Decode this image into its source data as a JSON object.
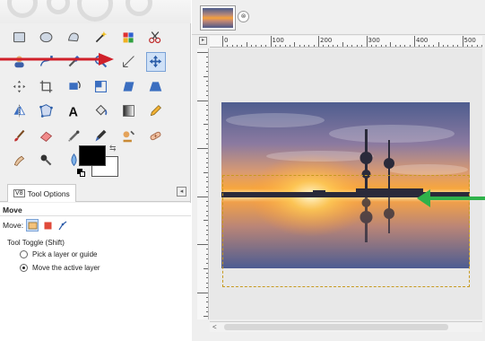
{
  "toolbox": {
    "tools": [
      {
        "name": "rect-select-icon",
        "active": false
      },
      {
        "name": "ellipse-select-icon",
        "active": false
      },
      {
        "name": "free-select-icon",
        "active": false
      },
      {
        "name": "fuzzy-select-icon",
        "active": false
      },
      {
        "name": "color-select-icon",
        "active": false
      },
      {
        "name": "scissors-select-icon",
        "active": false
      },
      {
        "name": "foreground-select-icon",
        "active": false
      },
      {
        "name": "paths-icon",
        "active": false
      },
      {
        "name": "color-picker-icon",
        "active": false
      },
      {
        "name": "zoom-icon",
        "active": false
      },
      {
        "name": "measure-icon",
        "active": false
      },
      {
        "name": "move-tool-icon",
        "active": true
      },
      {
        "name": "align-icon",
        "active": false
      },
      {
        "name": "crop-icon",
        "active": false
      },
      {
        "name": "rotate-icon",
        "active": false
      },
      {
        "name": "scale-icon",
        "active": false
      },
      {
        "name": "shear-icon",
        "active": false
      },
      {
        "name": "perspective-icon",
        "active": false
      },
      {
        "name": "flip-icon",
        "active": false
      },
      {
        "name": "cage-transform-icon",
        "active": false
      },
      {
        "name": "text-tool-icon",
        "active": false
      },
      {
        "name": "bucket-fill-icon",
        "active": false
      },
      {
        "name": "blend-icon",
        "active": false
      },
      {
        "name": "pencil-icon",
        "active": false
      },
      {
        "name": "paintbrush-icon",
        "active": false
      },
      {
        "name": "eraser-icon",
        "active": false
      },
      {
        "name": "airbrush-icon",
        "active": false
      },
      {
        "name": "ink-icon",
        "active": false
      },
      {
        "name": "clone-icon",
        "active": false
      },
      {
        "name": "heal-icon",
        "active": false
      },
      {
        "name": "smudge-icon",
        "active": false
      },
      {
        "name": "dodge-burn-icon",
        "active": false
      },
      {
        "name": "blur-sharpen-icon",
        "active": false
      }
    ],
    "foreground_color": "#000000",
    "background_color": "#ffffff"
  },
  "tool_options": {
    "tab_icon": "V8",
    "tab_label": "Tool Options",
    "title": "Move",
    "move_label": "Move:",
    "toggle_label": "Tool Toggle  (Shift)",
    "options": [
      {
        "label": "Pick a layer or guide",
        "selected": false
      },
      {
        "label": "Move the active layer",
        "selected": true
      }
    ]
  },
  "image_window": {
    "close_glyph": "⊗",
    "ruler_numbers": [
      "0",
      "100",
      "200",
      "300",
      "400",
      "500"
    ],
    "scroll_left_glyph": "<"
  },
  "annotations": {
    "red_arrow_color": "#d0202a",
    "green_arrow_color": "#2fb24a"
  }
}
